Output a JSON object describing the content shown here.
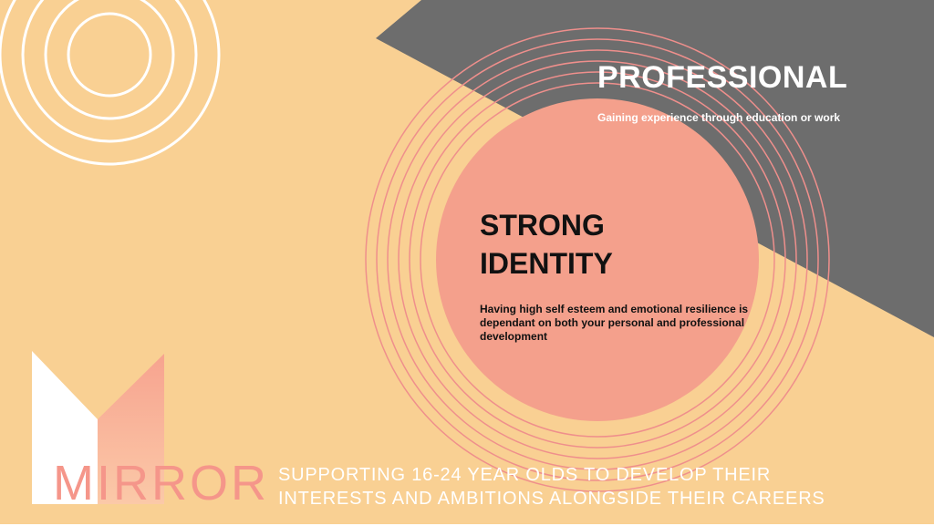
{
  "colors": {
    "background": "#f9d093",
    "grey_triangle": "#6d6d6d",
    "circle_fill": "#f4a08c",
    "ring_stroke": "#f0908a",
    "brand_pink": "#f5968a"
  },
  "professional": {
    "title": "PROFESSIONAL",
    "subtitle": "Gaining experience through education or work"
  },
  "identity": {
    "title": "STRONG IDENTITY",
    "body": "Having high self esteem and emotional resilience is dependant on both your personal and professional development"
  },
  "brand": {
    "name": "MIRROR",
    "tagline_line1": "SUPPORTING 16-24 YEAR OLDS TO DEVELOP THEIR",
    "tagline_line2": "INTERESTS AND AMBITIONS ALONGSIDE THEIR CAREERS"
  }
}
